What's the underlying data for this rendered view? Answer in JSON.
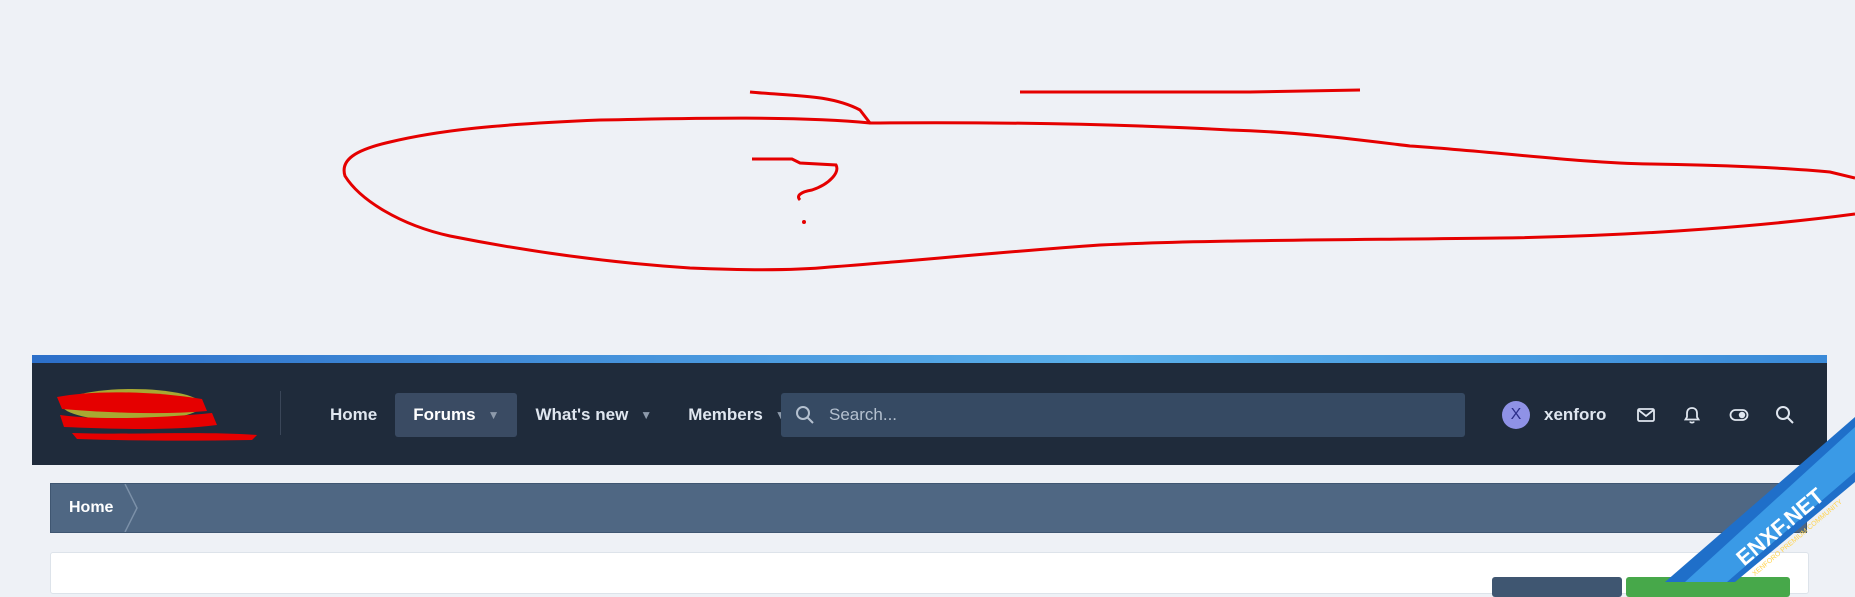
{
  "nav": {
    "items": [
      {
        "label": "Home"
      },
      {
        "label": "Forums"
      },
      {
        "label": "What's new"
      },
      {
        "label": "Members"
      }
    ],
    "search_placeholder": "Search..."
  },
  "user": {
    "avatar_letter": "X",
    "name": "xenforo"
  },
  "breadcrumb": {
    "home": "Home"
  },
  "annotation": {
    "mark": "?"
  },
  "watermark": {
    "text": "ENXF.NET",
    "subtext": "XENFORO PREMIUM COMMUNITY"
  },
  "colors": {
    "page_bg": "#eef1f6",
    "navbar_bg": "#1f2b3b",
    "accent_bar": "#3a8ad8",
    "breadcrumb_bg": "#4f6783",
    "annotation_red": "#e50000"
  }
}
